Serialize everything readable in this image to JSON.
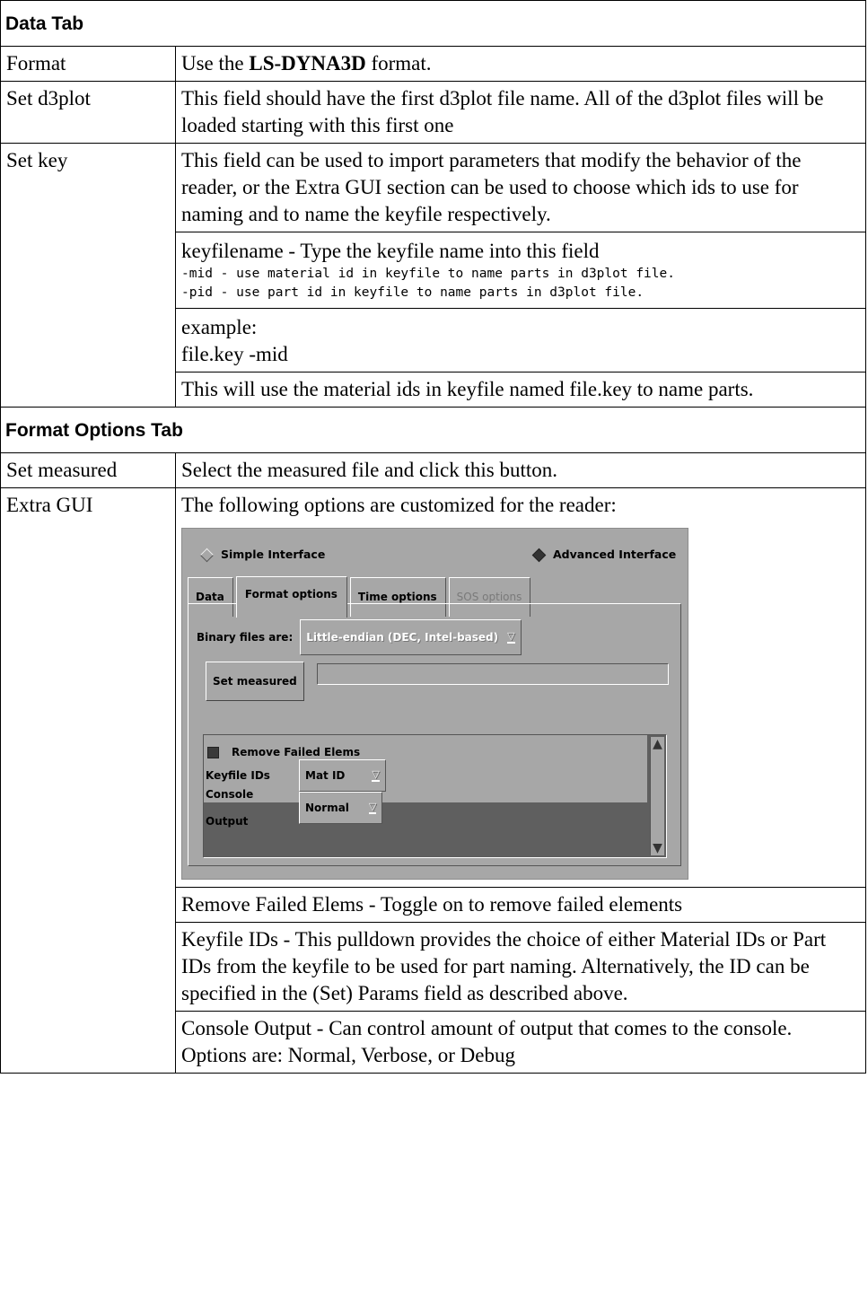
{
  "sections": {
    "data_tab": "Data Tab",
    "format_options_tab": "Format Options Tab"
  },
  "rows": {
    "format": {
      "label": "Format",
      "pre": "Use the ",
      "bold": "LS-DYNA3D",
      "post": " format."
    },
    "set_d3plot": {
      "label": "Set d3plot",
      "desc": "This field should have the first d3plot file name. All of the d3plot files will be loaded starting with this first one"
    },
    "set_key": {
      "label": "Set key",
      "desc": "This field can be used to import parameters that modify the behavior of the reader, or the Extra GUI section can be used to choose which ids to use for naming and to name the keyfile respectively.",
      "keyfilename": "keyfilename - Type the keyfile name into this field",
      "mid": "-mid - use material id in keyfile to name parts in d3plot file.",
      "pid": "-pid - use part id in keyfile to name parts in d3plot file.",
      "example_label": "example:",
      "example_value": "file.key -mid",
      "example_note": "This will use the material ids in keyfile named file.key to name parts."
    },
    "set_measured": {
      "label": "Set measured",
      "desc": "Select the measured file and click this button."
    },
    "extra_gui": {
      "label": "Extra GUI",
      "desc": "The following options are customized for the reader:",
      "remove_failed": "Remove Failed Elems - Toggle on to remove failed elements",
      "keyfile_ids": "Keyfile IDs - This pulldown provides the choice of either Material IDs or Part IDs from the keyfile to be used for part naming. Alternatively, the ID can be specified in the (Set) Params field as described above.",
      "console_output": "Console Output - Can control amount of output that comes to the console. Options are: Normal, Verbose, or Debug"
    }
  },
  "gui": {
    "simple_interface": "Simple Interface",
    "advanced_interface": "Advanced Interface",
    "tabs": [
      "Data",
      "Format options",
      "Time options",
      "SOS options"
    ],
    "binary_label": "Binary files are:",
    "binary_value": "Little-endian (DEC, Intel-based)",
    "set_measured_button": "Set measured",
    "remove_failed_label": "Remove Failed Elems",
    "keyfile_ids_label": "Keyfile IDs",
    "keyfile_ids_value": "Mat ID",
    "console_output_label": "Console Output",
    "console_output_value": "Normal"
  }
}
